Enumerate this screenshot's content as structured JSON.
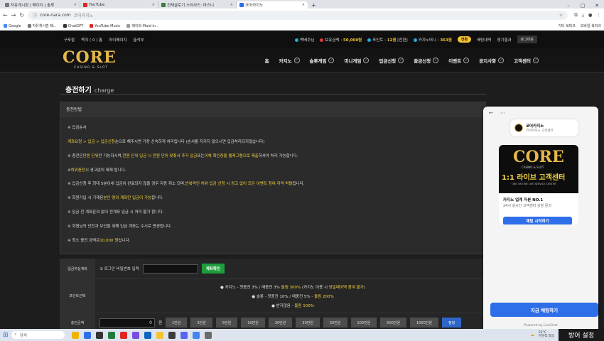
{
  "browser": {
    "tabs": [
      {
        "label": "자유게시판 | 페이지 | 솔루",
        "color": "#777"
      },
      {
        "label": "YouTube",
        "color": "#e02424"
      },
      {
        "label": "전체글로기 스타사드: 마스니",
        "color": "#3b7d3b"
      },
      {
        "label": "코어카지노",
        "color": "#2f6ee9",
        "active": true
      }
    ],
    "url_host": "core-nara.com",
    "url_title": "코어카지노",
    "bookmarks": [
      {
        "label": "Google",
        "color": "#4285f4"
      },
      {
        "label": "자유게시판 페...",
        "color": "#777"
      },
      {
        "label": "ChatGPT",
        "color": "#333"
      },
      {
        "label": "YouTube Music",
        "color": "#e02424"
      },
      {
        "label": "메이와 Maid in...",
        "color": "#999"
      }
    ],
    "bookmarks_right": [
      "기타 북마크",
      "모바일 북마크"
    ]
  },
  "topnav": {
    "left": [
      "구포함",
      "쪽지 ( 0 ) 통",
      "마이페이지",
      "출석부"
    ],
    "user": "백배주님",
    "cash_label": "보유금액 :",
    "cash_value": "50,000원",
    "point_label": "포인트 :",
    "point_value": "12원",
    "point_convert": "[전환]",
    "casino_money_label": "카지노머니 :",
    "casino_money_value": "363원",
    "convert_btn": "전환",
    "bet_history": "배팅내역",
    "results": "경기결과",
    "logout": "로그아웃"
  },
  "logo": {
    "main": "CORE",
    "sub": "CASINO & SLOT"
  },
  "menu": [
    "홈",
    "카지노",
    "슬롯게임",
    "미니게임",
    "입금신청",
    "출금신청",
    "이벤트",
    "공지사항",
    "고객센터"
  ],
  "page": {
    "title": "충전하기",
    "title_en": "charge",
    "section": "충전방법",
    "notes": [
      {
        "parts": [
          {
            "t": "※ 입금순서",
            "y": false
          }
        ]
      },
      {
        "parts": [
          {
            "t": "계좌요청 > 입금 > 입금신청",
            "y": true
          },
          {
            "t": " 순으로 해주시면 가장 신속하게 처리됩니다 (순서를 지키지 않으시면 입금처리되지않습니다)",
            "y": false
          }
        ]
      },
      {
        "parts": [
          {
            "t": "※ 충전은 ",
            "y": false
          },
          {
            "t": "만원 단위",
            "y": true
          },
          {
            "t": "만 가능하시며, ",
            "y": false
          },
          {
            "t": "천원 단위 입금 시 만원 단위 맞춰서 추가 입금",
            "y": true
          },
          {
            "t": " 또는 ",
            "y": false
          },
          {
            "t": "이체 확인증을 텔레그램으로 제출",
            "y": true
          },
          {
            "t": " 하셔야 처리 가능합니다.",
            "y": false
          }
        ]
      },
      {
        "parts": [
          {
            "t": "※ ",
            "y": false
          },
          {
            "t": "허위충전",
            "y": true
          },
          {
            "t": " 시 경고없이 제재 됩니다.",
            "y": false
          }
        ]
      },
      {
        "parts": [
          {
            "t": "※ 입금신청 후 최대 5분이내 입금이 완료되지 않을 경우 자동 취소 되며, ",
            "y": false
          },
          {
            "t": "반복적인 허위 입금 신청 시 경고 없이 모든 이벤트 참여 자격 박탈",
            "y": true
          },
          {
            "t": "됩니다.",
            "y": false
          }
        ]
      },
      {
        "parts": [
          {
            "t": "※ 회원가입 시 기재된 ",
            "y": false
          },
          {
            "t": "본인 명의 계좌만 입금이 가능",
            "y": true
          },
          {
            "t": " 합니다.",
            "y": false
          }
        ]
      },
      {
        "parts": [
          {
            "t": "※ 입금 전 계좌문의 없이 전계좌 입금 시 처리 불가 합니다.",
            "y": false
          }
        ]
      },
      {
        "parts": [
          {
            "t": "※ 회원님의 안전과 보안을 위해 입금 계좌는 수시로 변경됩니다.",
            "y": false
          }
        ]
      },
      {
        "parts": [
          {
            "t": "※ 최소 충전 금액은 ",
            "y": false
          },
          {
            "t": "10,000 원",
            "y": true
          },
          {
            "t": " 입니다.",
            "y": false
          }
        ]
      }
    ],
    "account_label": "입금하실계좌",
    "account_text": "① 로그인 비밀번호 입력",
    "account_btn": "계좌확인",
    "bonus_label": "포인트선택",
    "bonus_options": [
      {
        "parts": [
          {
            "t": "● 카지노 - 첫충전 3% / 매충전 3% ",
            "y": false
          },
          {
            "t": "돌림 300%",
            "y": true
          },
          {
            "t": " (카지노 이용 시 ",
            "y": false
          },
          {
            "t": "당일페이백 참여 불가",
            "y": true
          },
          {
            "t": ")",
            "y": false
          }
        ]
      },
      {
        "parts": [
          {
            "t": "● 슬롯 - 첫충전 10% / 매충전 5% - ",
            "y": false
          },
          {
            "t": "돌림 200%",
            "y": true
          }
        ]
      },
      {
        "parts": [
          {
            "t": "● 받지않음 - ",
            "y": false
          },
          {
            "t": "돌림 100%",
            "y": true
          }
        ]
      }
    ],
    "amount_label": "충전금액",
    "amount_input": "0",
    "amount_unit": "원",
    "amount_buttons": [
      "1만원",
      "3만원",
      "5만원",
      "10만원",
      "20만원",
      "30만원",
      "50만원",
      "100만원",
      "500만원",
      "1000만원"
    ],
    "reset_btn": "정정"
  },
  "chat": {
    "agent_name": "코어카지노",
    "agent_role": "코어카지노 고객센터",
    "banner_main": "CORE",
    "banner_sub": "CASINO & SLOT",
    "banner_line": "1:1 라이브 고객센터",
    "banner_en": "ONE ON ONE LIVE SERVICE CENTER",
    "desc1": "카지노 업계 자본 NO.1",
    "desc2": "24시 실시간 고객센터 상담 문의",
    "start_btn": "채팅 시작하기",
    "chat_now": "지금 채팅하기",
    "powered": "Powered by LiveChat"
  },
  "taskbar": {
    "search": "검색",
    "weather_temp": "22°C",
    "weather_desc": "부분적 맑음",
    "ime": "방어 설정",
    "apps": [
      "#f0b400",
      "#2f6ee9",
      "#333",
      "#1f7a3a",
      "#e02424",
      "#7a4be0",
      "#0a66c2",
      "#f4c430",
      "#3c3c3c",
      "#5865f2",
      "#4285f4",
      "#6b6b6b"
    ]
  }
}
